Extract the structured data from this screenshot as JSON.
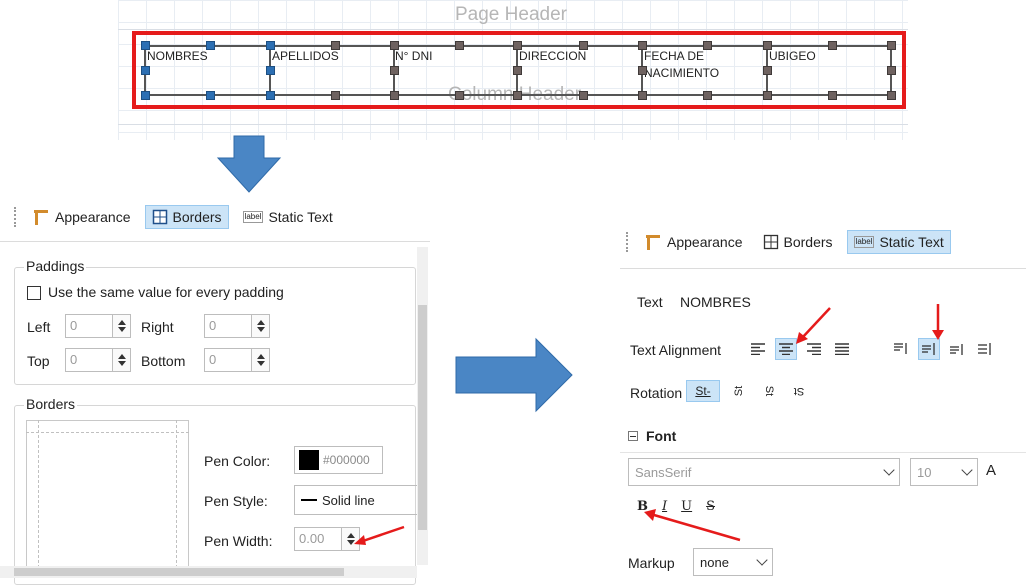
{
  "designer": {
    "page_header_title": "Page Header",
    "column_header_title": "Column Header",
    "fields": [
      "NOMBRES",
      "APELLIDOS",
      "N° DNI",
      "DIRECCION",
      "FECHA DE\nNACIMIENTO",
      "UBIGEO"
    ]
  },
  "left_panel": {
    "tabs": [
      {
        "label": "Appearance",
        "icon": "appearance-icon",
        "active": false
      },
      {
        "label": "Borders",
        "icon": "borders-icon",
        "active": true
      },
      {
        "label": "Static Text",
        "icon": "static-text-icon",
        "icon_text": "label",
        "active": false
      }
    ],
    "paddings": {
      "legend": "Paddings",
      "same_value_label": "Use the same value for every padding",
      "same_value_checked": false,
      "left_label": "Left",
      "left_value": "0",
      "right_label": "Right",
      "right_value": "0",
      "top_label": "Top",
      "top_value": "0",
      "bottom_label": "Bottom",
      "bottom_value": "0"
    },
    "borders": {
      "legend": "Borders",
      "pen_color_label": "Pen Color:",
      "pen_color_value": "#000000",
      "pen_style_label": "Pen Style:",
      "pen_style_value": "Solid line",
      "pen_width_label": "Pen Width:",
      "pen_width_value": "0.00"
    }
  },
  "right_panel": {
    "tabs": [
      {
        "label": "Appearance",
        "icon": "appearance-icon",
        "active": false
      },
      {
        "label": "Borders",
        "icon": "borders-icon",
        "active": false
      },
      {
        "label": "Static Text",
        "icon": "static-text-icon",
        "icon_text": "label",
        "active": true
      }
    ],
    "text_label": "Text",
    "text_value": "NOMBRES",
    "text_alignment_label": "Text Alignment",
    "rotation_label": "Rotation",
    "rotation_options": [
      "St-",
      "St",
      "St",
      "St"
    ],
    "font_section": "Font",
    "font_name": "SansSerif",
    "font_size": "10",
    "font_grow": "A",
    "style_buttons": [
      "B",
      "I",
      "U",
      "S"
    ],
    "markup_label": "Markup",
    "markup_value": "none"
  },
  "colors": {
    "selection_red": "#e51b1b",
    "arrow_blue": "#4a86c5",
    "active_tab": "#cce4f7",
    "handle_gray": "#6e6260",
    "handle_blue": "#2c6fb3"
  }
}
